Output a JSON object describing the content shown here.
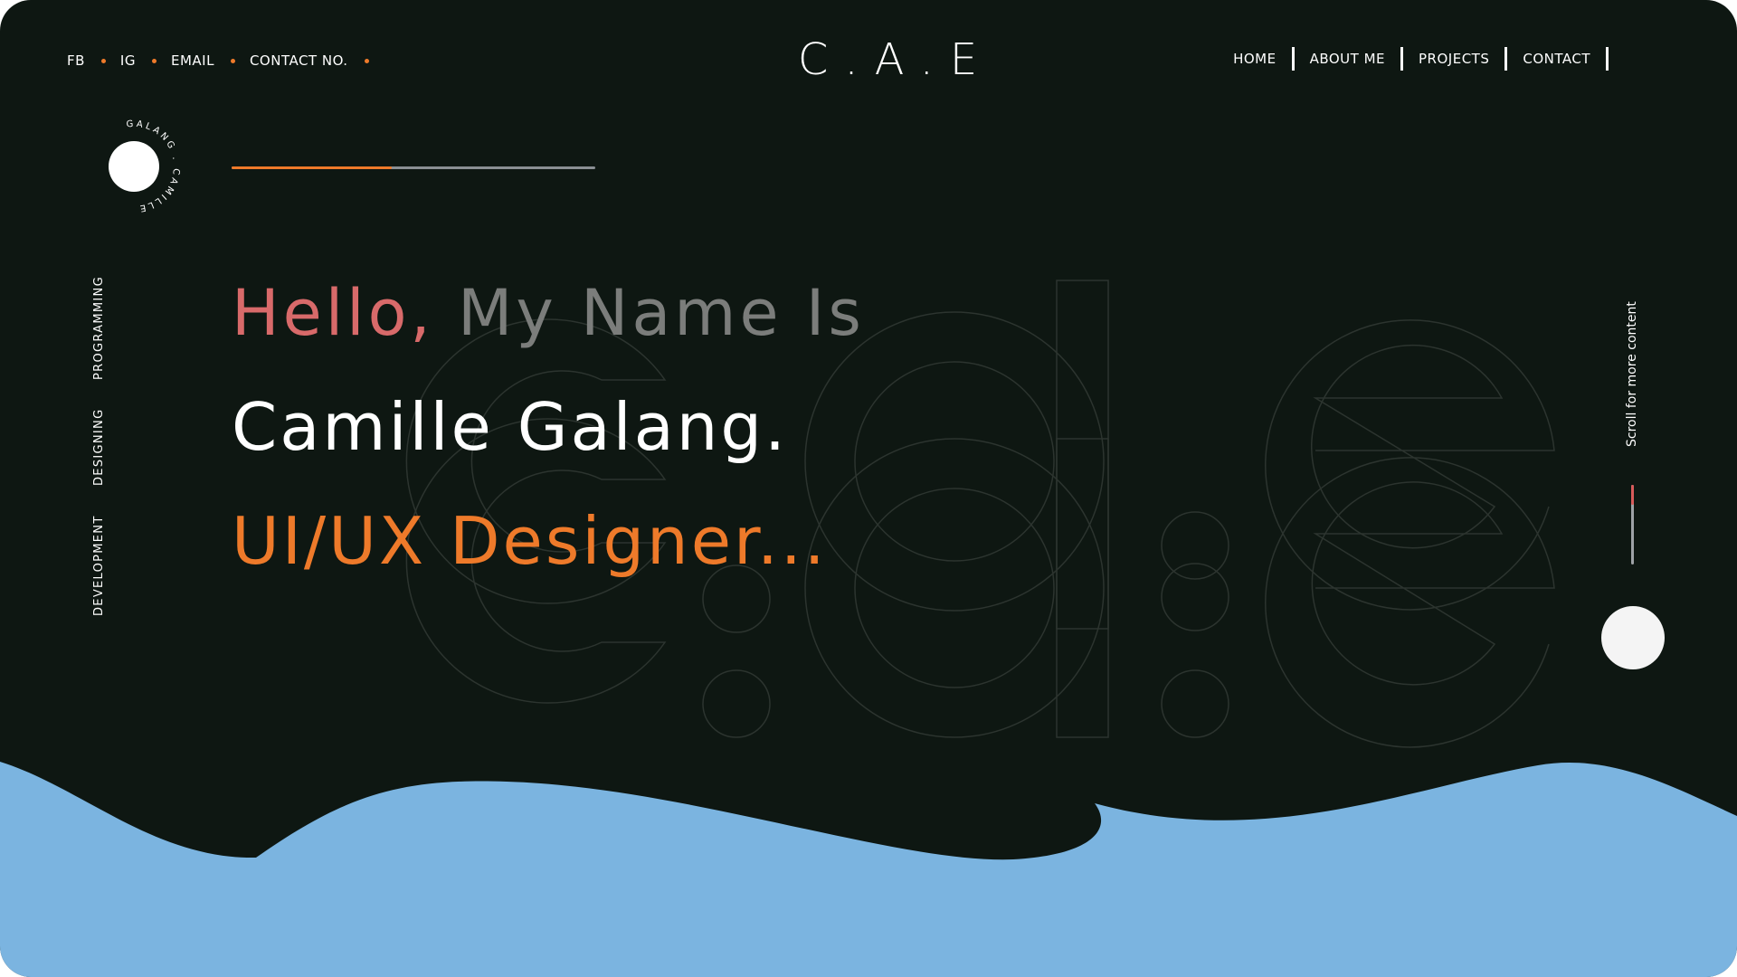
{
  "header": {
    "social_links": [
      "FB",
      "IG",
      "EMAIL",
      "CONTACT NO."
    ],
    "logo": "C.A.E",
    "nav": [
      "HOME",
      "ABOUT ME",
      "PROJECTS",
      "CONTACT"
    ]
  },
  "badge": {
    "circular_text": "GALANG . CAMILLE"
  },
  "progress": {
    "fraction": 0.44
  },
  "side_nav": [
    "PROGRAMMING",
    "DESIGNING",
    "DEVELOPMENT"
  ],
  "hero": {
    "greeting_1": "Hello,",
    "greeting_2": " My Name Is",
    "name": "Camille Galang.",
    "role": "UI/UX Designer..."
  },
  "background_letters": "c.a.e",
  "scroll": {
    "label": "Scroll for more content",
    "position": 0.25
  },
  "colors": {
    "background": "#0e1712",
    "accent_orange": "#ee7a2a",
    "accent_red": "#d86a6a",
    "wave_blue": "#7bb4e0"
  }
}
